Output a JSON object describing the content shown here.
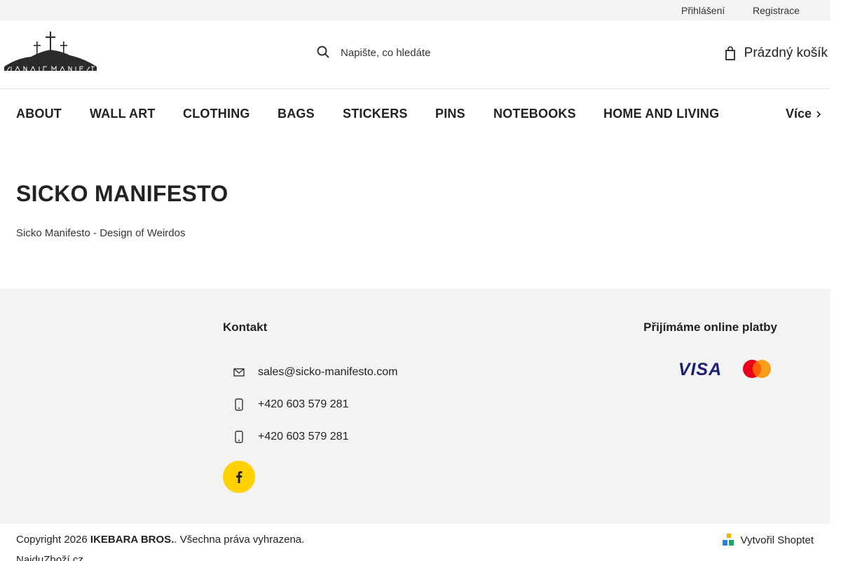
{
  "topbar": {
    "login": "Přihlášení",
    "register": "Registrace"
  },
  "header": {
    "logo_text": "Sicko Manifesto",
    "search_placeholder": "Napište, co hledáte",
    "cart_label": "Prázdný košík"
  },
  "nav": {
    "items": [
      "ABOUT",
      "WALL ART",
      "CLOTHING",
      "BAGS",
      "STICKERS",
      "PINS",
      "NOTEBOOKS",
      "HOME AND LIVING"
    ],
    "more_label": "Více"
  },
  "main": {
    "title": "SICKO MANIFESTO",
    "subtitle": "Sicko Manifesto - Design of Weirdos"
  },
  "footer": {
    "contact_title": "Kontakt",
    "email": "sales@sicko-manifesto.com",
    "phone1": "+420 603 579 281",
    "phone2": "+420 603 579 281",
    "payments_title": "Přijímáme online platby",
    "visa_label": "VISA",
    "icons": {
      "email": "envelope-icon",
      "phone": "phone-icon",
      "facebook": "facebook-icon",
      "mastercard": "mastercard-logo"
    },
    "colors": {
      "facebook_bg": "#ffd200",
      "visa": "#1a1f71",
      "mc_red": "#eb001b",
      "mc_yellow": "#f79e1b"
    }
  },
  "bottom": {
    "copyright_prefix": "Copyright 2026",
    "company": "IKEBARA BROS.",
    "copyright_suffix": ". Všechna práva vyhrazena.",
    "shoptet_label": "Vytvořil Shoptet",
    "najdu": "NajduZboží.cz"
  }
}
